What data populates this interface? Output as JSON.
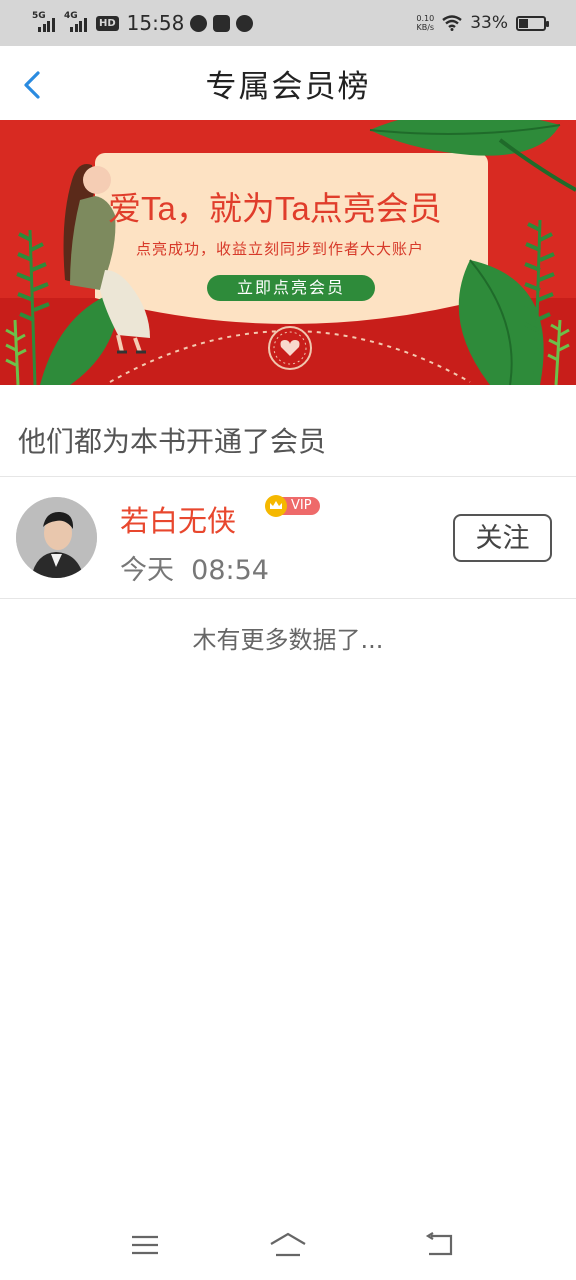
{
  "status_bar": {
    "signal1_label": "5G",
    "signal2_label": "4G",
    "hd_label": "HD",
    "time": "15:58",
    "net_speed_value": "0.10",
    "net_speed_unit": "KB/s",
    "battery": "33%",
    "battery_level": 0.33
  },
  "nav": {
    "title": "专属会员榜",
    "back_icon": "chevron-left-icon"
  },
  "banner": {
    "headline": "爱Ta，就为Ta点亮会员",
    "subtitle": "点亮成功，收益立刻同步到作者大大账户",
    "cta": "立即点亮会员"
  },
  "section": {
    "title": "他们都为本书开通了会员"
  },
  "members": [
    {
      "name": "若白无侠",
      "badge": "VIP",
      "time": "今天  08:54",
      "follow_label": "关注"
    }
  ],
  "list_footer": "木有更多数据了...",
  "colors": {
    "accent_blue": "#2a8be0",
    "name_red": "#e8472e",
    "banner_red": "#d82a22",
    "leaf_green": "#2e8b3a"
  },
  "bottom_nav": {
    "menu_icon": "menu-icon",
    "home_icon": "home-icon",
    "back_icon": "back-icon"
  }
}
